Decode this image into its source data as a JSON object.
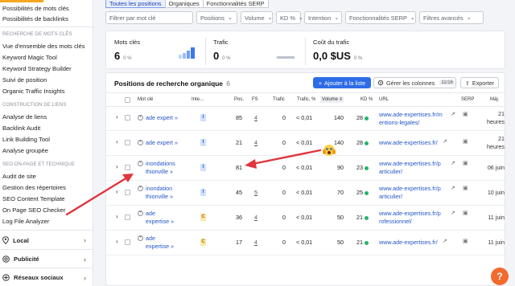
{
  "tabs": [
    {
      "label": "Toutes les positions",
      "active": true
    },
    {
      "label": "Organiques",
      "active": false
    },
    {
      "label": "Fonctionnalités SERP",
      "active": false
    }
  ],
  "sidebar": {
    "items_top": [
      "Possibilités de mots clés",
      "Possibilités de backlinks"
    ],
    "section_research": "RECHERCHE DE MOTS CLÉS",
    "research_items": [
      "Vue d'ensemble des mots clés",
      "Keyword Magic Tool",
      "Keyword Strategy Builder",
      "Suivi de position",
      "Organic Traffic Insights"
    ],
    "section_links": "CONSTRUCTION DE LIENS",
    "links_items": [
      "Analyse de liens",
      "Backlink Audit",
      "Link Building Tool",
      "Analyse groupée"
    ],
    "section_seo": "SEO ON-PAGE ET TECHNIQUE",
    "seo_items": [
      "Audit de site",
      "Gestion des répertoires",
      "SEO Content Template",
      "On Page SEO Checker",
      "Log File Analyzer"
    ],
    "categories": [
      {
        "label": "Local",
        "icon": "location-pin-icon"
      },
      {
        "label": "Publicité",
        "icon": "target-icon"
      },
      {
        "label": "Réseaux sociaux",
        "icon": "social-icon"
      }
    ]
  },
  "filters": {
    "search_placeholder": "Filtrer par mot clé",
    "dropdowns": [
      "Positions",
      "Volume",
      "KD %",
      "Intention",
      "Fonctionnalités SERP",
      "Filtres avancés"
    ]
  },
  "stats": {
    "keywords": {
      "label": "Mots clés",
      "value": "6",
      "pct": "0 %"
    },
    "traffic": {
      "label": "Trafic",
      "value": "0",
      "pct": "0 %"
    },
    "cost": {
      "label": "Coût du trafic",
      "value": "0,0 $US",
      "pct": "0 %"
    }
  },
  "panel": {
    "title": "Positions de recherche organique",
    "count": "6",
    "add_button": "Ajouter à la liste",
    "columns_button": "Gérer les colonnes",
    "columns_badge": "11/16",
    "export_button": "Exporter"
  },
  "table": {
    "headers": {
      "keyword": "Mot clé",
      "intent": "Inte...",
      "pos": "Pos.",
      "fs": "FS",
      "traffic": "Trafic",
      "traffic_pct": "Trafic, %",
      "volume": "Volume",
      "kd": "KD %",
      "url": "URL",
      "serp": "SERP",
      "updated": "Màj."
    },
    "rows": [
      {
        "keyword": [
          "ade expert"
        ],
        "intent": "I",
        "pos": "85",
        "fs": "4",
        "traffic": "0",
        "traffic_pct": "< 0,01",
        "volume": "140",
        "kd": "28",
        "url": [
          "www.ade-expertises.fr/m",
          "entions-legales/"
        ],
        "updated": [
          "21",
          "heures"
        ]
      },
      {
        "keyword": [
          "ade expert"
        ],
        "intent": "I",
        "pos": "21",
        "fs": "4",
        "traffic": "0",
        "traffic_pct": "< 0,01",
        "volume": "140",
        "kd": "28",
        "url": [
          "www.ade-expertises.fr/"
        ],
        "updated": [
          "21",
          "heures"
        ]
      },
      {
        "keyword": [
          "inondations",
          "thionville"
        ],
        "intent": "I",
        "pos": "81",
        "fs": "",
        "traffic": "0",
        "traffic_pct": "< 0,01",
        "volume": "90",
        "kd": "23",
        "url": [
          "www.ade-expertises.fr/p",
          "articulier/"
        ],
        "updated": [
          "06 juin"
        ]
      },
      {
        "keyword": [
          "inondation",
          "thionville"
        ],
        "intent": "I",
        "pos": "45",
        "fs": "5",
        "traffic": "0",
        "traffic_pct": "< 0,01",
        "volume": "70",
        "kd": "25",
        "url": [
          "www.ade-expertises.fr/p",
          "articulier/"
        ],
        "updated": [
          "10 juin"
        ]
      },
      {
        "keyword": [
          "ade",
          "expertise"
        ],
        "intent": "C",
        "pos": "36",
        "fs": "4",
        "traffic": "0",
        "traffic_pct": "< 0,01",
        "volume": "50",
        "kd": "21",
        "url": [
          "www.ade-expertises.fr/p",
          "rofessionnel/"
        ],
        "updated": [
          "11 juin"
        ]
      },
      {
        "keyword": [
          "ade",
          "expertise"
        ],
        "intent": "C",
        "pos": "17",
        "fs": "4",
        "traffic": "0",
        "traffic_pct": "< 0,01",
        "volume": "50",
        "kd": "21",
        "url": [
          "www.ade-expertises.fr/"
        ],
        "updated": [
          "11 juin"
        ]
      }
    ]
  },
  "colors": {
    "accent": "#2e6ce6",
    "arrow": "#e0353d",
    "kd_dot": "#24b56b",
    "help": "#f26a2e"
  }
}
